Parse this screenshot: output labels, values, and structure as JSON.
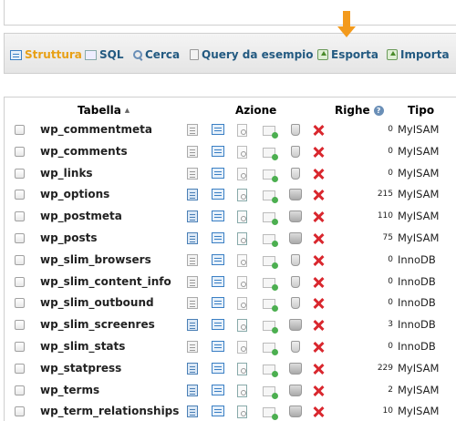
{
  "toolbar": {
    "tabs": [
      {
        "label": "Struttura",
        "icon": "structure-icon",
        "active": true
      },
      {
        "label": "SQL",
        "icon": "sql-icon",
        "active": false
      },
      {
        "label": "Cerca",
        "icon": "search-icon",
        "active": false
      },
      {
        "label": "Query da esempio",
        "icon": "query-icon",
        "active": false
      },
      {
        "label": "Esporta",
        "icon": "export-icon",
        "active": false
      },
      {
        "label": "Importa",
        "icon": "import-icon",
        "active": false
      }
    ],
    "highlight_color": "#f39a1c"
  },
  "table": {
    "headers": {
      "name": "Tabella",
      "action": "Azione",
      "rows": "Righe",
      "type": "Tipo"
    },
    "rows": [
      {
        "name": "wp_commentmeta",
        "rows": "0",
        "type": "MyISAM",
        "browse": false,
        "empty": false
      },
      {
        "name": "wp_comments",
        "rows": "0",
        "type": "MyISAM",
        "browse": false,
        "empty": false
      },
      {
        "name": "wp_links",
        "rows": "0",
        "type": "MyISAM",
        "browse": false,
        "empty": false
      },
      {
        "name": "wp_options",
        "rows": "215",
        "type": "MyISAM",
        "browse": true,
        "empty": true
      },
      {
        "name": "wp_postmeta",
        "rows": "110",
        "type": "MyISAM",
        "browse": true,
        "empty": true
      },
      {
        "name": "wp_posts",
        "rows": "75",
        "type": "MyISAM",
        "browse": true,
        "empty": true
      },
      {
        "name": "wp_slim_browsers",
        "rows": "0",
        "type": "InnoDB",
        "browse": false,
        "empty": false
      },
      {
        "name": "wp_slim_content_info",
        "rows": "0",
        "type": "InnoDB",
        "browse": false,
        "empty": false
      },
      {
        "name": "wp_slim_outbound",
        "rows": "0",
        "type": "InnoDB",
        "browse": false,
        "empty": false
      },
      {
        "name": "wp_slim_screenres",
        "rows": "3",
        "type": "InnoDB",
        "browse": true,
        "empty": true
      },
      {
        "name": "wp_slim_stats",
        "rows": "0",
        "type": "InnoDB",
        "browse": false,
        "empty": false
      },
      {
        "name": "wp_statpress",
        "rows": "229",
        "type": "MyISAM",
        "browse": true,
        "empty": true
      },
      {
        "name": "wp_terms",
        "rows": "2",
        "type": "MyISAM",
        "browse": true,
        "empty": true
      },
      {
        "name": "wp_term_relationships",
        "rows": "10",
        "type": "MyISAM",
        "browse": true,
        "empty": true
      }
    ]
  }
}
